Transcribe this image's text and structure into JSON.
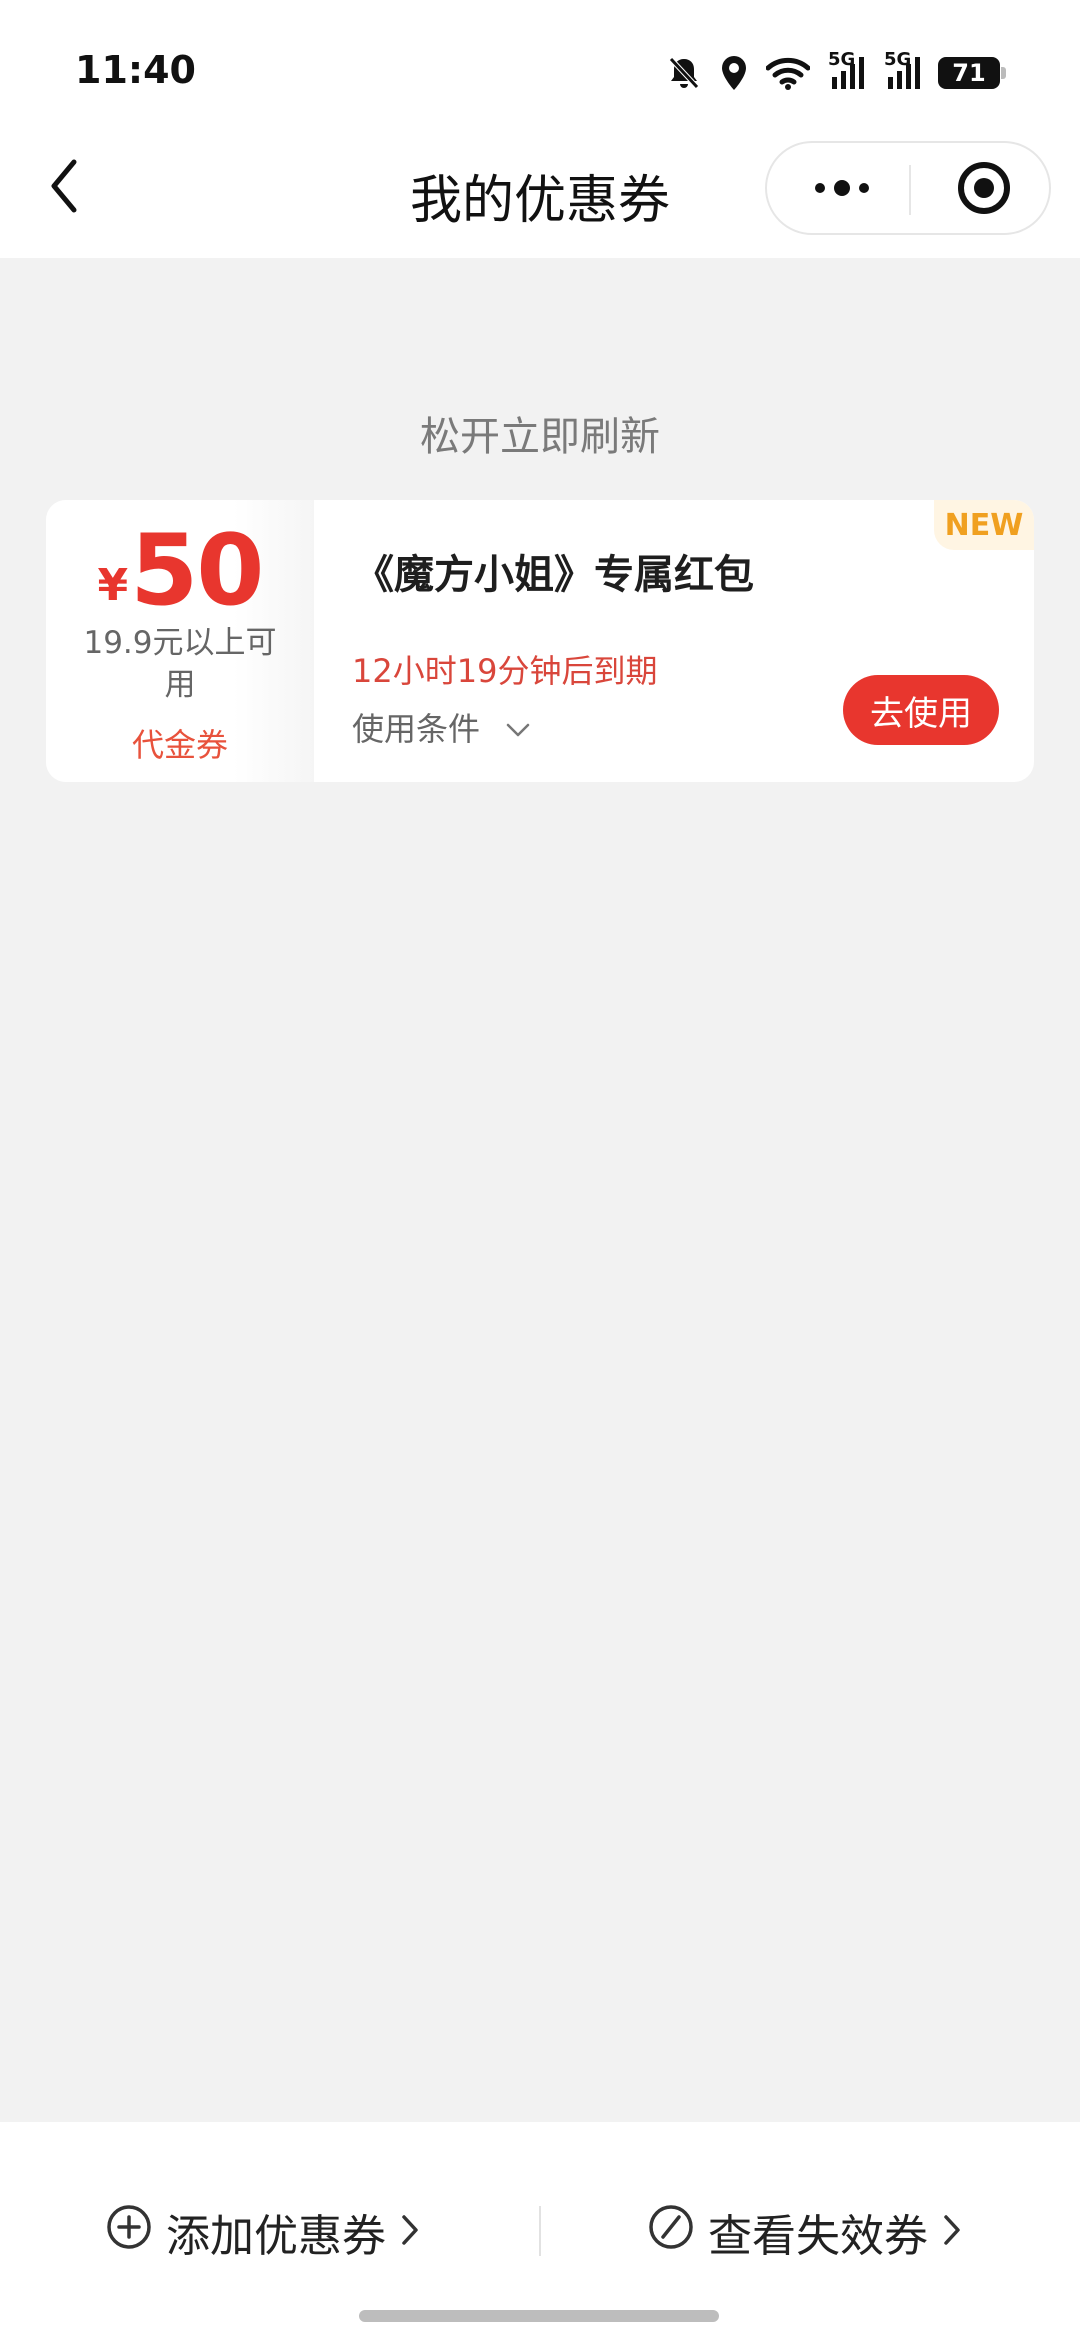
{
  "status_bar": {
    "time": "11:40",
    "network_1": "5G",
    "network_2": "5G",
    "battery": "71"
  },
  "nav": {
    "title": "我的优惠券"
  },
  "refresh_hint": "松开立即刷新",
  "coupon": {
    "currency": "¥",
    "amount": "50",
    "threshold": "19.9元以上可用",
    "type": "代金券",
    "badge": "NEW",
    "title": "《魔方小姐》专属红包",
    "expire": "12小时19分钟后到期",
    "conditions_label": "使用条件",
    "use_button": "去使用"
  },
  "bottom": {
    "add_label": "添加优惠券",
    "expired_label": "查看失效券"
  },
  "colors": {
    "accent": "#e8362e",
    "badge": "#f0a020",
    "background": "#f2f2f2"
  },
  "icons": {
    "back": "chevron-left-icon",
    "more": "more-dots-icon",
    "close": "target-icon",
    "add": "plus-circle-icon",
    "expired": "forbidden-icon"
  }
}
